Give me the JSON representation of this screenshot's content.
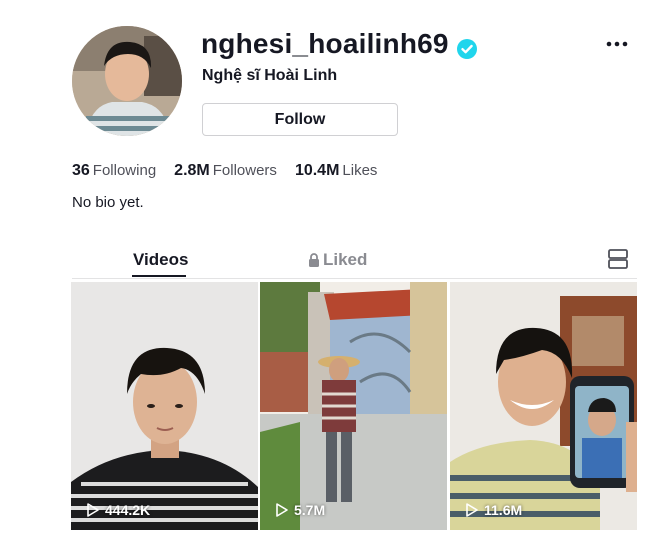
{
  "profile": {
    "username": "nghesi_hoailinh69",
    "nickname": "Nghệ sĩ Hoài Linh",
    "follow_label": "Follow",
    "verified": true,
    "bio": "No bio yet."
  },
  "stats": {
    "following_count": "36",
    "following_label": "Following",
    "followers_count": "2.8M",
    "followers_label": "Followers",
    "likes_count": "10.4M",
    "likes_label": "Likes"
  },
  "tabs": {
    "videos_label": "Videos",
    "liked_label": "Liked"
  },
  "videos": [
    {
      "views": "444.2K"
    },
    {
      "views": "5.7M"
    },
    {
      "views": "11.6M"
    }
  ],
  "icons": {
    "verified": "verified-badge-icon",
    "more": "more-options-icon",
    "lock": "lock-icon",
    "layout": "layout-toggle-icon",
    "play": "play-icon"
  },
  "colors": {
    "verified": "#20d5ec",
    "text_primary": "#161823",
    "text_secondary": "#8a8b91"
  }
}
